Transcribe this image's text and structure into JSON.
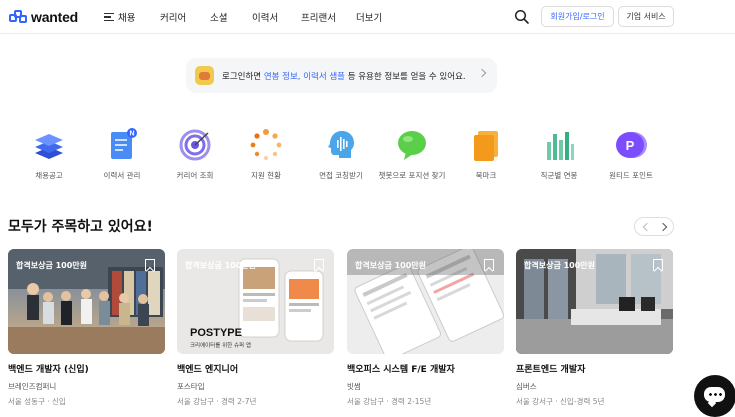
{
  "header": {
    "logo_text": "wanted",
    "nav": [
      "채용",
      "커리어",
      "소셜",
      "이력서",
      "프리랜서",
      "더보기"
    ],
    "signup_label": "회원가입/로그인",
    "biz_label": "기업 서비스"
  },
  "banner": {
    "text_before": "로그인하면 ",
    "highlight": "연봉 정보, 이력서 샘플",
    "text_after": " 등 유용한 정보를 얻을 수 있어요."
  },
  "quick_menu": [
    {
      "label": "채용공고",
      "icon": "layers-icon"
    },
    {
      "label": "이력서 관리",
      "icon": "resume-icon",
      "badge": "N"
    },
    {
      "label": "커리어 조회",
      "icon": "target-icon"
    },
    {
      "label": "지원 현황",
      "icon": "progress-icon"
    },
    {
      "label": "면접 코칭받기",
      "icon": "head-icon"
    },
    {
      "label": "챗봇으로 포지션 찾기",
      "icon": "chat-bubble-icon"
    },
    {
      "label": "북마크",
      "icon": "bookmark-icon"
    },
    {
      "label": "직군별 연봉",
      "icon": "bar-chart-icon"
    },
    {
      "label": "원티드 포인트",
      "icon": "point-icon",
      "symbol": "P"
    }
  ],
  "section": {
    "title": "모두가 주목하고 있어요!"
  },
  "cards": [
    {
      "badge": "합격보상금 100만원",
      "title": "백엔드 개발자 (신입)",
      "company": "브레인즈컴퍼니",
      "meta": "서울 성동구 · 신입"
    },
    {
      "badge": "합격보상금 100만원",
      "title": "백엔드 엔지니어",
      "company": "포스타입",
      "meta": "서울 강남구 · 경력 2-7년",
      "image_text": "POSTYPE",
      "image_sub": "크리에이터를 위한 슈퍼 앱"
    },
    {
      "badge": "합격보상금 100만원",
      "title": "백오피스 시스템 F/E 개발자",
      "company": "빗썸",
      "meta": "서울 강남구 · 경력 2-15년"
    },
    {
      "badge": "합격보상금 100만원",
      "title": "프론트엔드 개발자",
      "company": "심버스",
      "meta": "서울 강서구 · 신입-경력 5년"
    }
  ]
}
